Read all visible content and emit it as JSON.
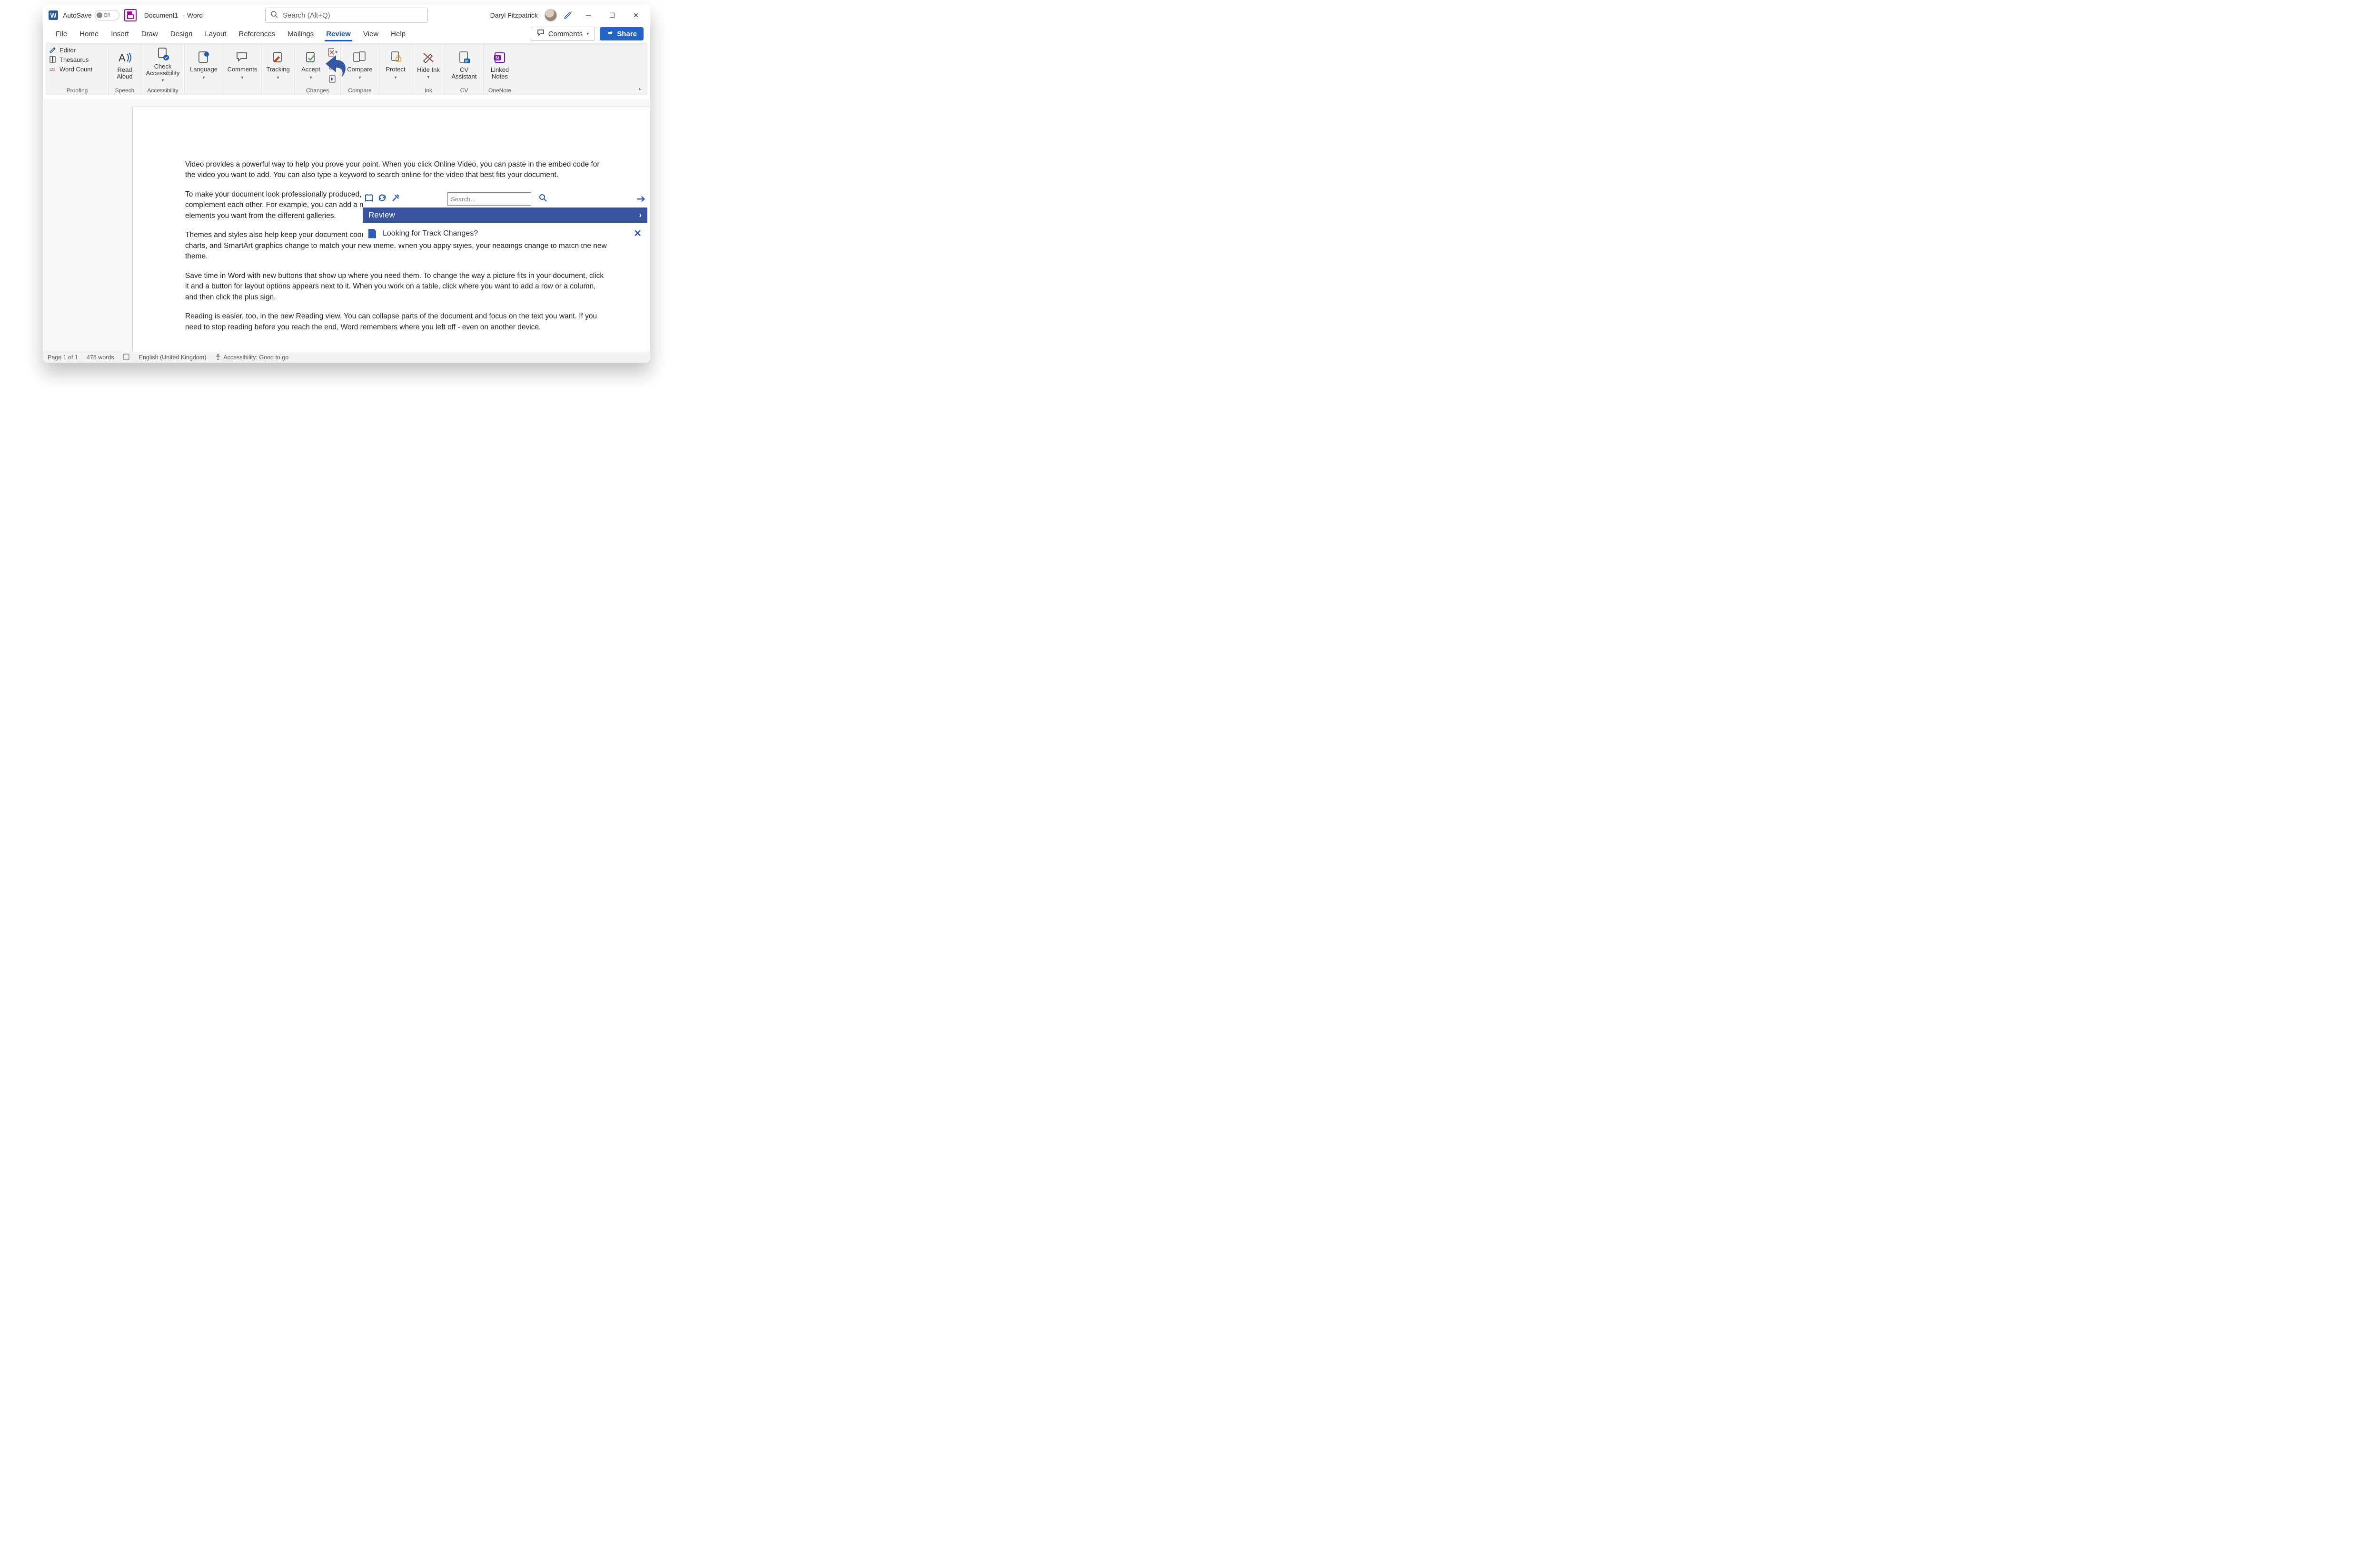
{
  "titlebar": {
    "autosave_label": "AutoSave",
    "autosave_state": "Off",
    "doc_name": "Document1",
    "app_suffix": "-  Word",
    "search_placeholder": "Search (Alt+Q)",
    "user_name": "Daryl Fitzpatrick"
  },
  "tabs": {
    "items": [
      "File",
      "Home",
      "Insert",
      "Draw",
      "Design",
      "Layout",
      "References",
      "Mailings",
      "Review",
      "View",
      "Help"
    ],
    "active_index": 8,
    "comments_label": "Comments",
    "share_label": "Share"
  },
  "ribbon": {
    "proofing": {
      "label": "Proofing",
      "editor": "Editor",
      "thesaurus": "Thesaurus",
      "wordcount": "Word Count"
    },
    "speech": {
      "label": "Speech",
      "read_aloud": "Read Aloud"
    },
    "accessibility": {
      "label": "Accessibility",
      "check": "Check Accessibility"
    },
    "language": {
      "label": "Language"
    },
    "comments": {
      "label": "Comments"
    },
    "tracking": {
      "label": "Tracking"
    },
    "changes": {
      "label": "Changes",
      "accept": "Accept"
    },
    "compare": {
      "label": "Compare",
      "button": "Compare"
    },
    "protect": {
      "label": "Protect"
    },
    "ink": {
      "label": "Ink",
      "hide": "Hide Ink"
    },
    "cv": {
      "label": "CV",
      "assistant": "CV Assistant"
    },
    "onenote": {
      "label": "OneNote",
      "linked": "Linked Notes"
    }
  },
  "document": {
    "p1": "Video provides a powerful way to help you prove your point. When you click Online Video, you can paste in the embed code for the video you want to add. You can also type a keyword to search online for the video that best fits your document.",
    "p2": "To make your document look professionally produced, Word provides header, footer, cover page, and text box designs that complement each other. For example, you can add a matching cover page, header, and sidebar. Click Insert and then choose the elements you want from the different galleries.",
    "p3": "Themes and styles also help keep your document coordinated. When you click Design and choose a new Theme, the pictures, charts, and SmartArt graphics change to match your new theme. When you apply styles, your headings change to match the new theme.",
    "p4": "Save time in Word with new buttons that show up where you need them. To change the way a picture fits in your document, click it and a button for layout options appears next to it. When you work on a table, click where you want to add a row or a column, and then click the plus sign.",
    "p5": "Reading is easier, too, in the new Reading view. You can collapse parts of the document and focus on the text you want. If you need to stop reading before you reach the end, Word remembers where you left off - even on another device."
  },
  "overlay": {
    "search_placeholder": "Search...",
    "header": "Review",
    "row1": "Looking for Track Changes?"
  },
  "statusbar": {
    "page": "Page 1 of 1",
    "words": "478 words",
    "language": "English (United Kingdom)",
    "accessibility": "Accessibility: Good to go"
  }
}
